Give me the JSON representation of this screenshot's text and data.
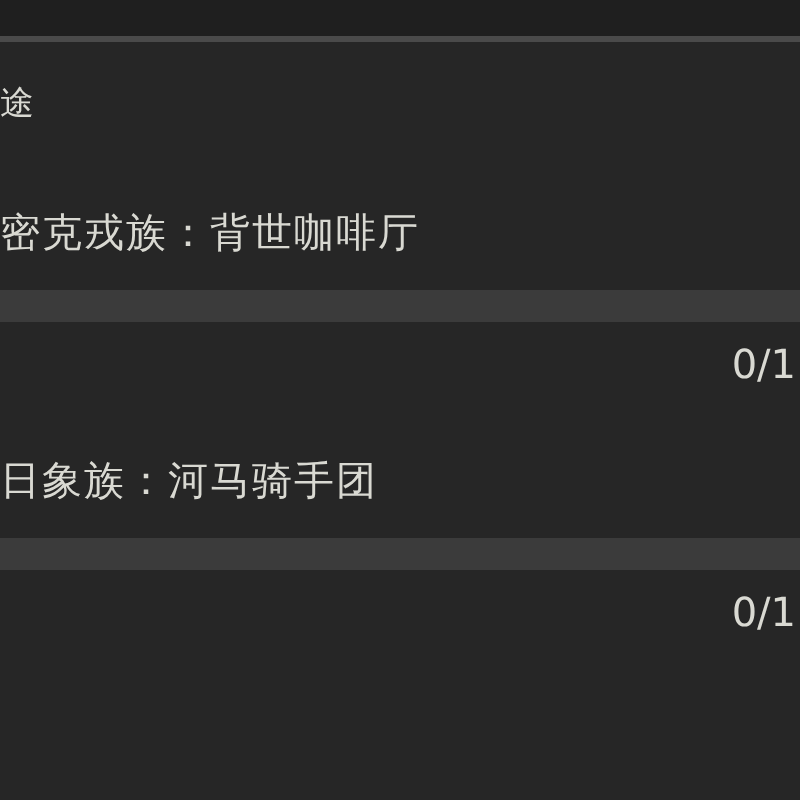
{
  "heading": "途",
  "quests": [
    {
      "title": "密克戎族：背世咖啡厅",
      "progress": "0/1"
    },
    {
      "title": "日象族：河马骑手团",
      "progress": "0/1"
    }
  ]
}
